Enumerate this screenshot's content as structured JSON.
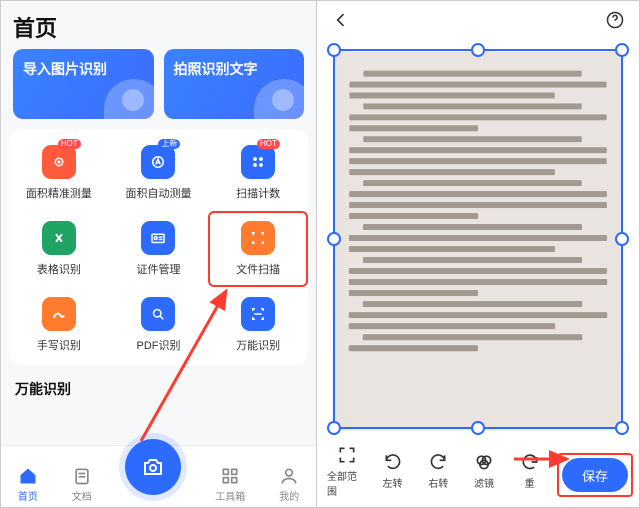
{
  "leftPhone": {
    "title": "首页",
    "cards": [
      {
        "label": "导入图片识别"
      },
      {
        "label": "拍照识别文字"
      }
    ],
    "grid1": [
      {
        "label": "面积精准测量",
        "color": "#ff5a3c",
        "badge": "HOT"
      },
      {
        "label": "面积自动测量",
        "color": "#2d6bff",
        "badge": "上新"
      },
      {
        "label": "扫描计数",
        "color": "#2d6bff",
        "badge": "HOT"
      },
      {
        "label": "表格识别",
        "color": "#1fa463",
        "badge": ""
      },
      {
        "label": "证件管理",
        "color": "#2d6bff",
        "badge": ""
      },
      {
        "label": "文件扫描",
        "color": "#ff7b2e",
        "badge": ""
      },
      {
        "label": "手写识别",
        "color": "#ff7b2e",
        "badge": ""
      },
      {
        "label": "PDF识别",
        "color": "#2d6bff",
        "badge": ""
      },
      {
        "label": "万能识别",
        "color": "#2d6bff",
        "badge": ""
      }
    ],
    "section2": "万能识别",
    "tabs": [
      {
        "label": "首页"
      },
      {
        "label": "文档"
      },
      {
        "label": ""
      },
      {
        "label": "工具箱"
      },
      {
        "label": "我的"
      }
    ]
  },
  "rightPhone": {
    "tools": [
      {
        "label": "全部范围"
      },
      {
        "label": "左转"
      },
      {
        "label": "右转"
      },
      {
        "label": "滤镜"
      },
      {
        "label": "重"
      }
    ],
    "save": "保存"
  }
}
